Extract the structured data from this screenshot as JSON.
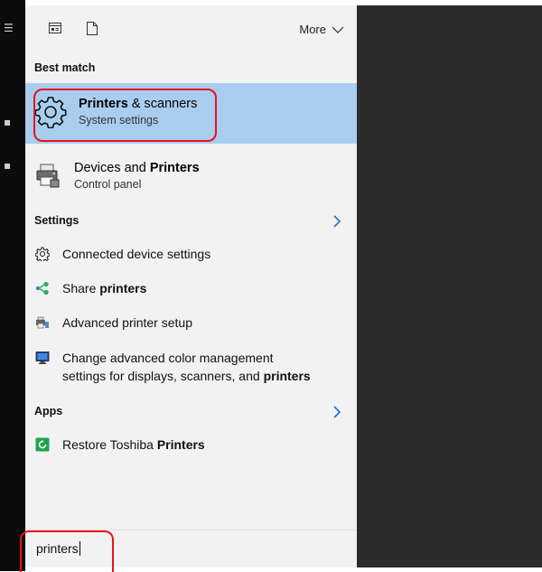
{
  "topbar": {
    "more_label": "More"
  },
  "best_match": {
    "label": "Best match",
    "items": [
      {
        "title_bold": "Printers",
        "title_rest": " & scanners",
        "subtitle": "System settings",
        "icon": "gear-icon"
      },
      {
        "title_pre": "Devices and ",
        "title_bold": "Printers",
        "subtitle": "Control panel",
        "icon": "printer-icon"
      }
    ]
  },
  "settings": {
    "label": "Settings",
    "items": [
      {
        "text": "Connected device settings",
        "icon": "gear-icon"
      },
      {
        "pre": "Share ",
        "bold": "printers",
        "icon": "share-icon"
      },
      {
        "text": "Advanced printer setup",
        "icon": "printer-setup-icon"
      },
      {
        "line1": "Change advanced color management",
        "line2_pre": "settings for displays, scanners, and ",
        "line2_bold": "printers",
        "icon": "monitor-icon"
      }
    ]
  },
  "apps": {
    "label": "Apps",
    "items": [
      {
        "pre": "Restore Toshiba ",
        "bold": "Printers",
        "icon": "restore-icon"
      }
    ]
  },
  "search": {
    "value": "printers"
  },
  "colors": {
    "highlight": "#a9cdee",
    "annotation": "#e8121d",
    "dark_pane": "#2b2b2b",
    "panel_bg": "#f2f2f2"
  }
}
